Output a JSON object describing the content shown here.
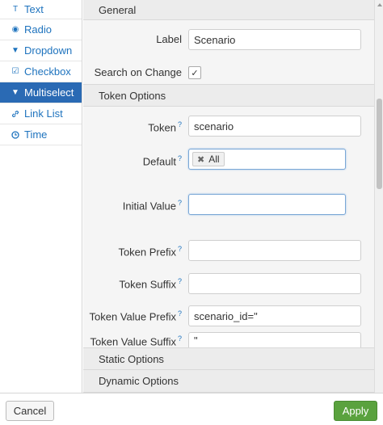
{
  "sidebar": {
    "items": [
      {
        "label": "Text",
        "icon": "text-icon",
        "glyph": "T"
      },
      {
        "label": "Radio",
        "icon": "radio-icon",
        "glyph": "◉"
      },
      {
        "label": "Dropdown",
        "icon": "dropdown-icon",
        "glyph": "▼"
      },
      {
        "label": "Checkbox",
        "icon": "checkbox-icon",
        "glyph": "☑"
      },
      {
        "label": "Multiselect",
        "icon": "multiselect-icon",
        "glyph": "▼"
      },
      {
        "label": "Link List",
        "icon": "link-icon",
        "glyph": "🔗"
      },
      {
        "label": "Time",
        "icon": "clock-icon",
        "glyph": "◷"
      }
    ],
    "active": "Multiselect"
  },
  "sections": {
    "general": "General",
    "token_options": "Token Options",
    "static_options": "Static Options",
    "dynamic_options": "Dynamic Options"
  },
  "general": {
    "label_label": "Label",
    "label_value": "Scenario",
    "search_on_change_label": "Search on Change",
    "search_on_change_checked": true,
    "check_glyph": "✓"
  },
  "token": {
    "token_label": "Token",
    "token_value": "scenario",
    "default_label": "Default",
    "default_chip": "All",
    "chip_remove_glyph": "✖",
    "initial_value_label": "Initial Value",
    "initial_value": "",
    "prefix_label": "Token Prefix",
    "prefix_value": "",
    "suffix_label": "Token Suffix",
    "suffix_value": "",
    "value_prefix_label": "Token Value Prefix",
    "value_prefix_value": "scenario_id=\"",
    "value_suffix_label": "Token Value Suffix",
    "value_suffix_value": "\"",
    "help_glyph": "?"
  },
  "footer": {
    "cancel_label": "Cancel",
    "apply_label": "Apply"
  },
  "colors": {
    "accent": "#2a6ab4",
    "link": "#1e73be",
    "apply": "#5aa23e"
  }
}
